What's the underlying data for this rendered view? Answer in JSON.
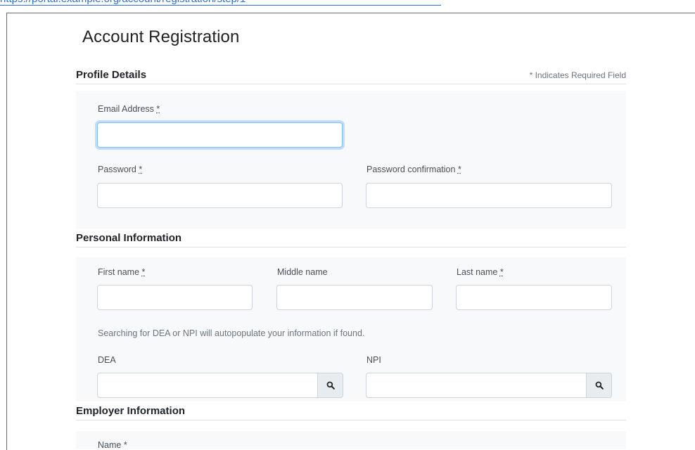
{
  "top_link": "https://portal.example.org/account/registration/step/1",
  "page": {
    "title": "Account Registration"
  },
  "profile": {
    "heading": "Profile Details",
    "required_note": "* Indicates Required Field",
    "email_label": "Email Address",
    "password_label": "Password",
    "password_confirm_label": "Password confirmation",
    "req": "*"
  },
  "personal": {
    "heading": "Personal Information",
    "first_label": "First name",
    "middle_label": "Middle name",
    "last_label": "Last name",
    "helper": "Searching for DEA or NPI will autopopulate your information if found.",
    "dea_label": "DEA",
    "npi_label": "NPI",
    "req": "*"
  },
  "employer": {
    "heading": "Employer Information",
    "name_label": "Name *"
  },
  "icons": {
    "search": "search-icon"
  }
}
